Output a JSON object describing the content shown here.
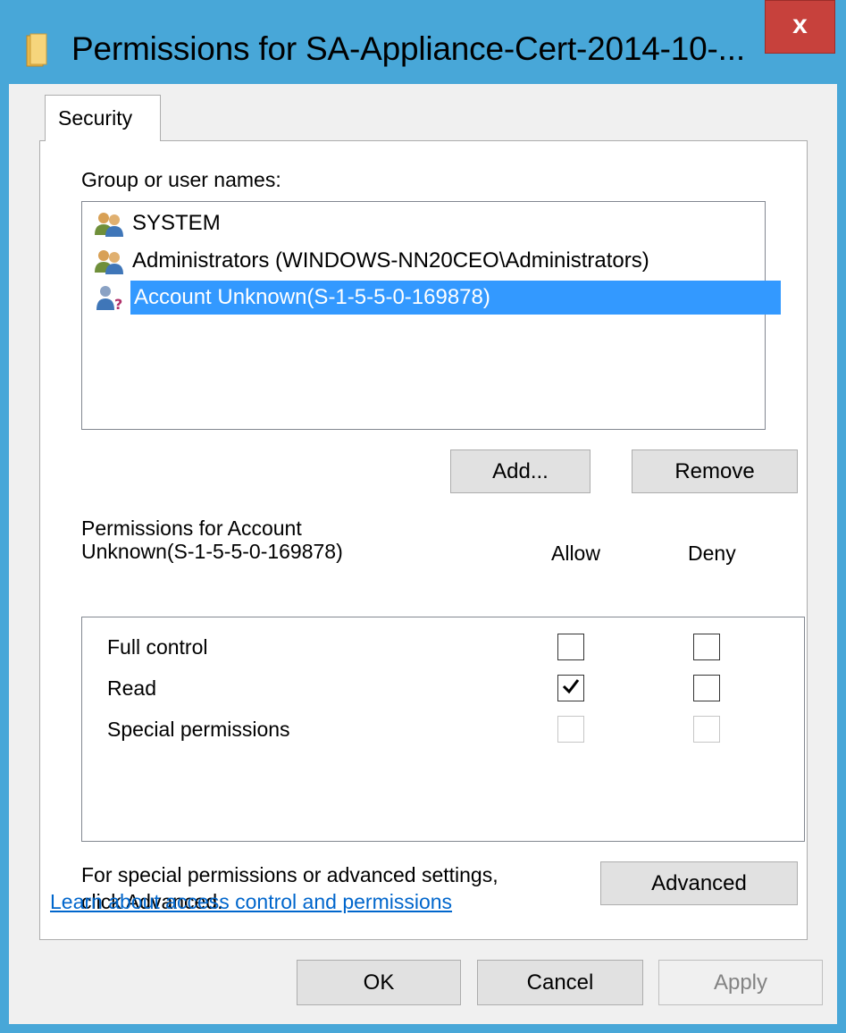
{
  "window": {
    "title": "Permissions for SA-Appliance-Cert-2014-10-...",
    "close_label": "x"
  },
  "tabs": [
    {
      "label": "Security"
    }
  ],
  "group_list": {
    "label": "Group or user names:",
    "items": [
      {
        "label": "SYSTEM",
        "icon": "users-group-icon"
      },
      {
        "label": "Administrators (WINDOWS-NN20CEO\\Administrators)",
        "icon": "users-group-icon"
      },
      {
        "label": "Account Unknown(S-1-5-5-0-169878)",
        "icon": "unknown-user-icon",
        "selected": true
      }
    ]
  },
  "list_buttons": {
    "add": "Add...",
    "remove": "Remove"
  },
  "permissions": {
    "label_line1": "Permissions for Account",
    "label_line2": "Unknown(S-1-5-5-0-169878)",
    "allow_header": "Allow",
    "deny_header": "Deny",
    "rows": [
      {
        "name": "Full control",
        "allow": false,
        "deny": false,
        "enabled": true
      },
      {
        "name": "Read",
        "allow": true,
        "deny": false,
        "enabled": true
      },
      {
        "name": "Special permissions",
        "allow": false,
        "deny": false,
        "enabled": false
      }
    ]
  },
  "advanced": {
    "text_line1": "For special permissions or advanced settings,",
    "text_line2": "click Advanced.",
    "button": "Advanced"
  },
  "link": "Learn about access control and permissions",
  "footer": {
    "ok": "OK",
    "cancel": "Cancel",
    "apply": "Apply"
  },
  "colors": {
    "title_bar": "#48a7d8",
    "close_button": "#c7413c",
    "selection": "#3399ff",
    "link": "#0066cc"
  }
}
